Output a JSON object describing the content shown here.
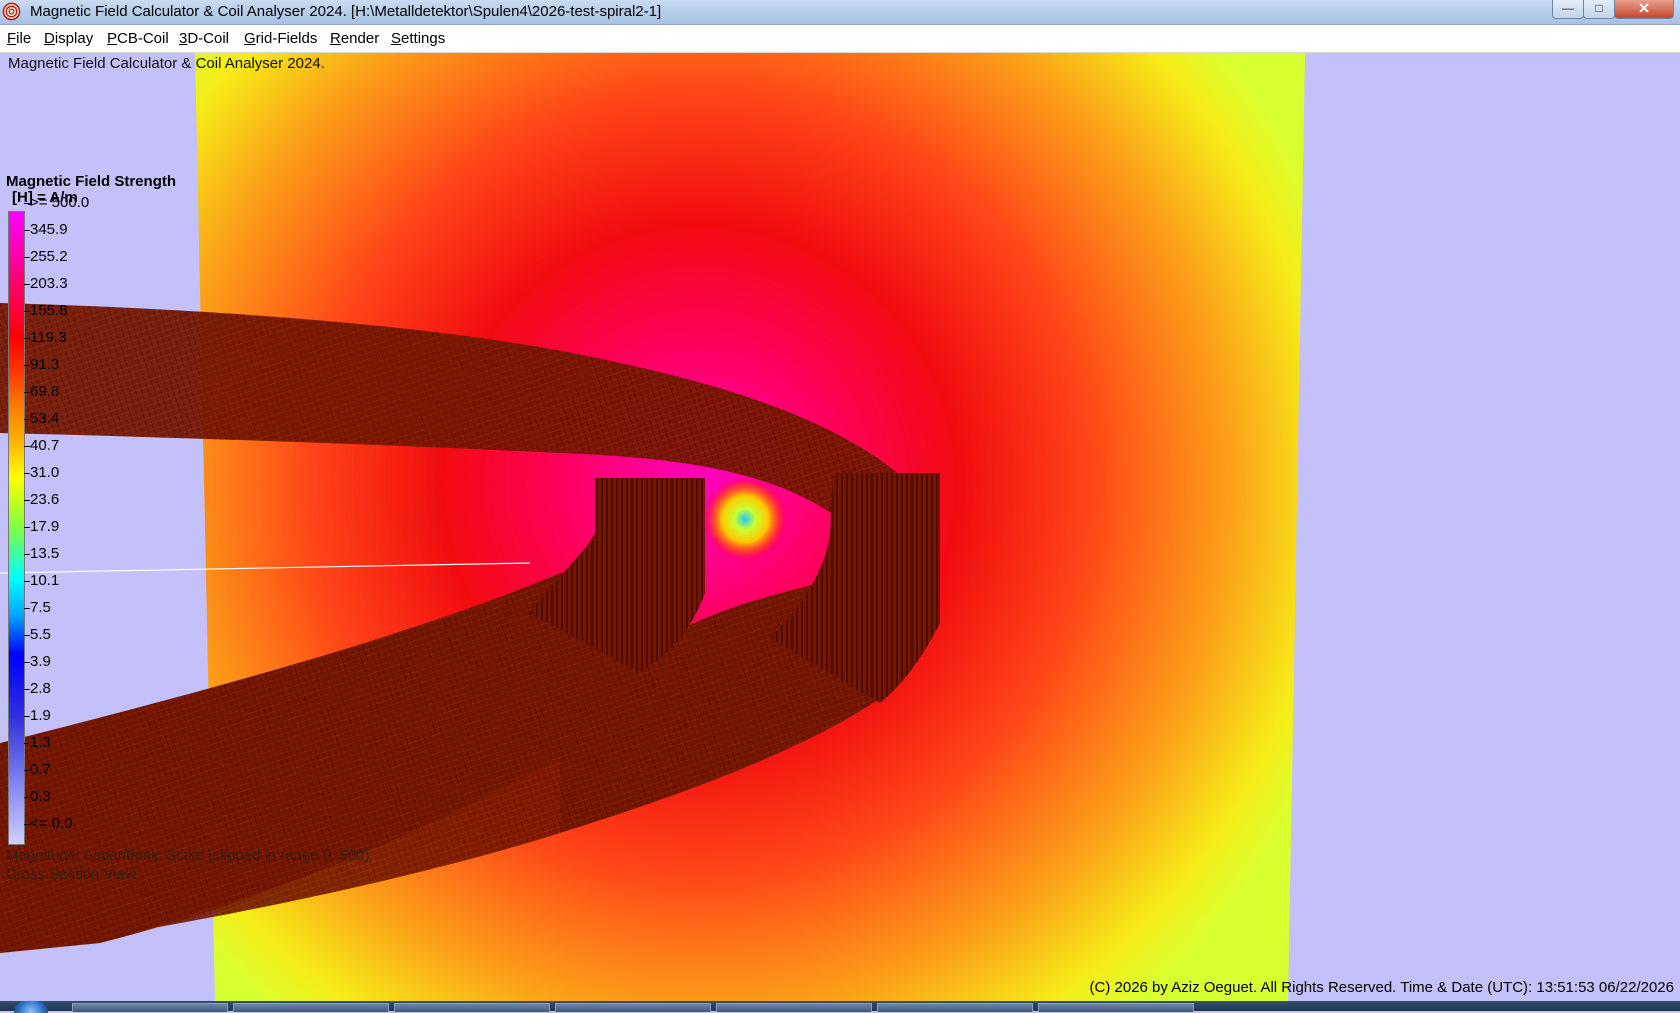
{
  "window": {
    "title": "Magnetic Field Calculator & Coil Analyser 2024.  [H:\\Metalldetektor\\Spulen4\\2026-test-spiral2-1]",
    "minimize_glyph": "—",
    "maximize_glyph": "□",
    "close_glyph": "✕"
  },
  "menu": {
    "items": [
      "File",
      "Display",
      "PCB-Coil",
      "3D-Coil",
      "Grid-Fields",
      "Render",
      "Settings"
    ]
  },
  "viewport": {
    "overlay_title": "Magnetic Field Calculator & Coil Analyser 2024.",
    "legend": {
      "title": "Magnetic Field Strength",
      "unit": "[H] = A/m",
      "ticks": [
        ">= 500.0",
        "345.9",
        "255.2",
        "203.3",
        "155.8",
        "119.3",
        "91.3",
        "69.8",
        "53.4",
        "40.7",
        "31.0",
        "23.6",
        "17.9",
        "13.5",
        "10.1",
        "7.5",
        "5.5",
        "3.9",
        "2.8",
        "1.9",
        "1.3",
        "0.7",
        "0.3",
        "<= 0.0"
      ]
    },
    "scale_note": "Magnitude: Logarithmic Scale (clipped in range 0..500)",
    "view_note": "Cross Section View",
    "copyright": "(C) 2026  by Aziz Oeguet. All Rights Reserved.  Time & Date (UTC): 13:51:53  06/22/2026"
  },
  "colors": {
    "background": "#c4c0fa",
    "coil": "#6e1400",
    "field_high": "#ff00aa",
    "field_mid": "#ff2020",
    "field_low": "#e8ff20"
  }
}
